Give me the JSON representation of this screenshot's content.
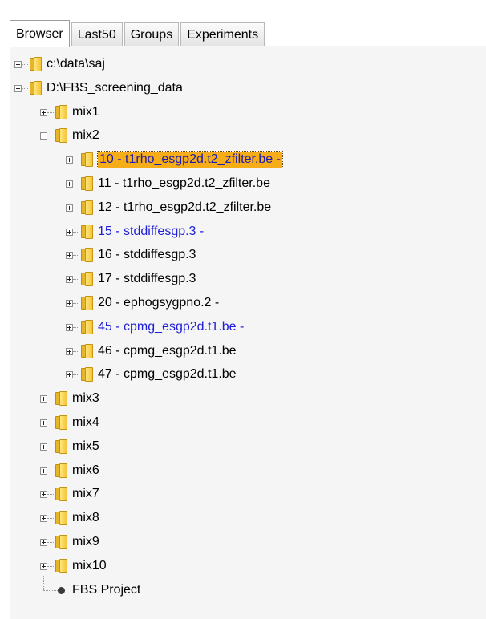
{
  "tabs": [
    {
      "label": "Browser",
      "active": true
    },
    {
      "label": "Last50",
      "active": false
    },
    {
      "label": "Groups",
      "active": false
    },
    {
      "label": "Experiments",
      "active": false
    }
  ],
  "tree": [
    {
      "label": "c:\\data\\saj",
      "level": 0,
      "expander": "plus",
      "icon": "folder-icon",
      "color": "#000000",
      "selected": false
    },
    {
      "label": "D:\\FBS_screening_data",
      "level": 0,
      "expander": "minus",
      "icon": "folder-icon",
      "color": "#000000",
      "selected": false
    },
    {
      "label": "mix1",
      "level": 1,
      "expander": "plus",
      "icon": "folder-icon",
      "color": "#000000",
      "selected": false
    },
    {
      "label": "mix2",
      "level": 1,
      "expander": "minus",
      "icon": "folder-icon",
      "color": "#000000",
      "selected": false
    },
    {
      "label": "10 - t1rho_esgp2d.t2_zfilter.be -",
      "level": 2,
      "expander": "plus",
      "icon": "folder-icon",
      "color": "#1c1cb0",
      "selected": true
    },
    {
      "label": "11 - t1rho_esgp2d.t2_zfilter.be",
      "level": 2,
      "expander": "plus",
      "icon": "folder-icon",
      "color": "#000000",
      "selected": false
    },
    {
      "label": "12 - t1rho_esgp2d.t2_zfilter.be",
      "level": 2,
      "expander": "plus",
      "icon": "folder-icon",
      "color": "#000000",
      "selected": false
    },
    {
      "label": "15 - stddiffesgp.3 -",
      "level": 2,
      "expander": "plus",
      "icon": "folder-icon",
      "color": "#2020d8",
      "selected": false
    },
    {
      "label": "16 - stddiffesgp.3",
      "level": 2,
      "expander": "plus",
      "icon": "folder-icon",
      "color": "#000000",
      "selected": false
    },
    {
      "label": "17 - stddiffesgp.3",
      "level": 2,
      "expander": "plus",
      "icon": "folder-icon",
      "color": "#000000",
      "selected": false
    },
    {
      "label": "20 - ephogsygpno.2 -",
      "level": 2,
      "expander": "plus",
      "icon": "folder-icon",
      "color": "#000000",
      "selected": false
    },
    {
      "label": "45 - cpmg_esgp2d.t1.be -",
      "level": 2,
      "expander": "plus",
      "icon": "folder-icon",
      "color": "#2020d8",
      "selected": false
    },
    {
      "label": "46 - cpmg_esgp2d.t1.be",
      "level": 2,
      "expander": "plus",
      "icon": "folder-icon",
      "color": "#000000",
      "selected": false
    },
    {
      "label": "47 - cpmg_esgp2d.t1.be",
      "level": 2,
      "expander": "plus",
      "icon": "folder-icon",
      "color": "#000000",
      "selected": false
    },
    {
      "label": "mix3",
      "level": 1,
      "expander": "plus",
      "icon": "folder-icon",
      "color": "#000000",
      "selected": false
    },
    {
      "label": "mix4",
      "level": 1,
      "expander": "plus",
      "icon": "folder-icon",
      "color": "#000000",
      "selected": false
    },
    {
      "label": "mix5",
      "level": 1,
      "expander": "plus",
      "icon": "folder-icon",
      "color": "#000000",
      "selected": false
    },
    {
      "label": "mix6",
      "level": 1,
      "expander": "plus",
      "icon": "folder-icon",
      "color": "#000000",
      "selected": false
    },
    {
      "label": "mix7",
      "level": 1,
      "expander": "plus",
      "icon": "folder-icon",
      "color": "#000000",
      "selected": false
    },
    {
      "label": "mix8",
      "level": 1,
      "expander": "plus",
      "icon": "folder-icon",
      "color": "#000000",
      "selected": false
    },
    {
      "label": "mix9",
      "level": 1,
      "expander": "plus",
      "icon": "folder-icon",
      "color": "#000000",
      "selected": false
    },
    {
      "label": "mix10",
      "level": 1,
      "expander": "plus",
      "icon": "folder-icon",
      "color": "#000000",
      "selected": false
    },
    {
      "label": "FBS Project",
      "level": 1,
      "expander": "none",
      "icon": "project-node-icon",
      "color": "#000000",
      "selected": false
    }
  ]
}
